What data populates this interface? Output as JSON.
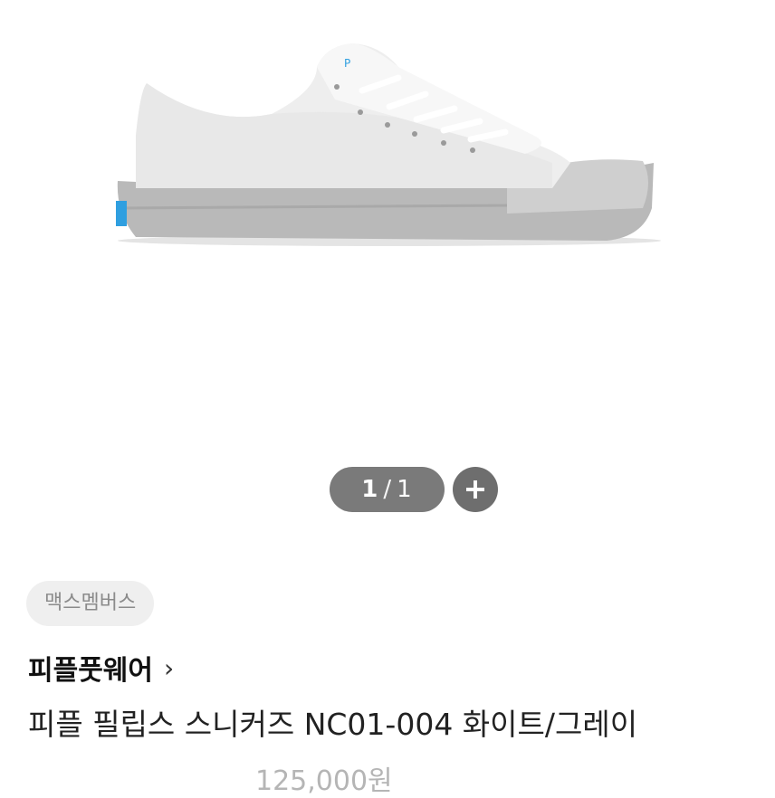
{
  "gallery": {
    "current": "1",
    "separator": "/",
    "total": "1",
    "zoom_icon": "plus-icon"
  },
  "product": {
    "badge": "맥스멤버스",
    "brand": "피플풋웨어",
    "brand_chevron": "›",
    "name": "피플 필립스 스니커즈 NC01-004 화이트/그레이",
    "price": "125,000원"
  },
  "colors": {
    "pager_bg": "#7a7a7a",
    "zoom_bg": "#6e6e6e",
    "badge_bg": "#efefef",
    "badge_text": "#8b8b8b",
    "price_text": "#b5b5b5"
  }
}
